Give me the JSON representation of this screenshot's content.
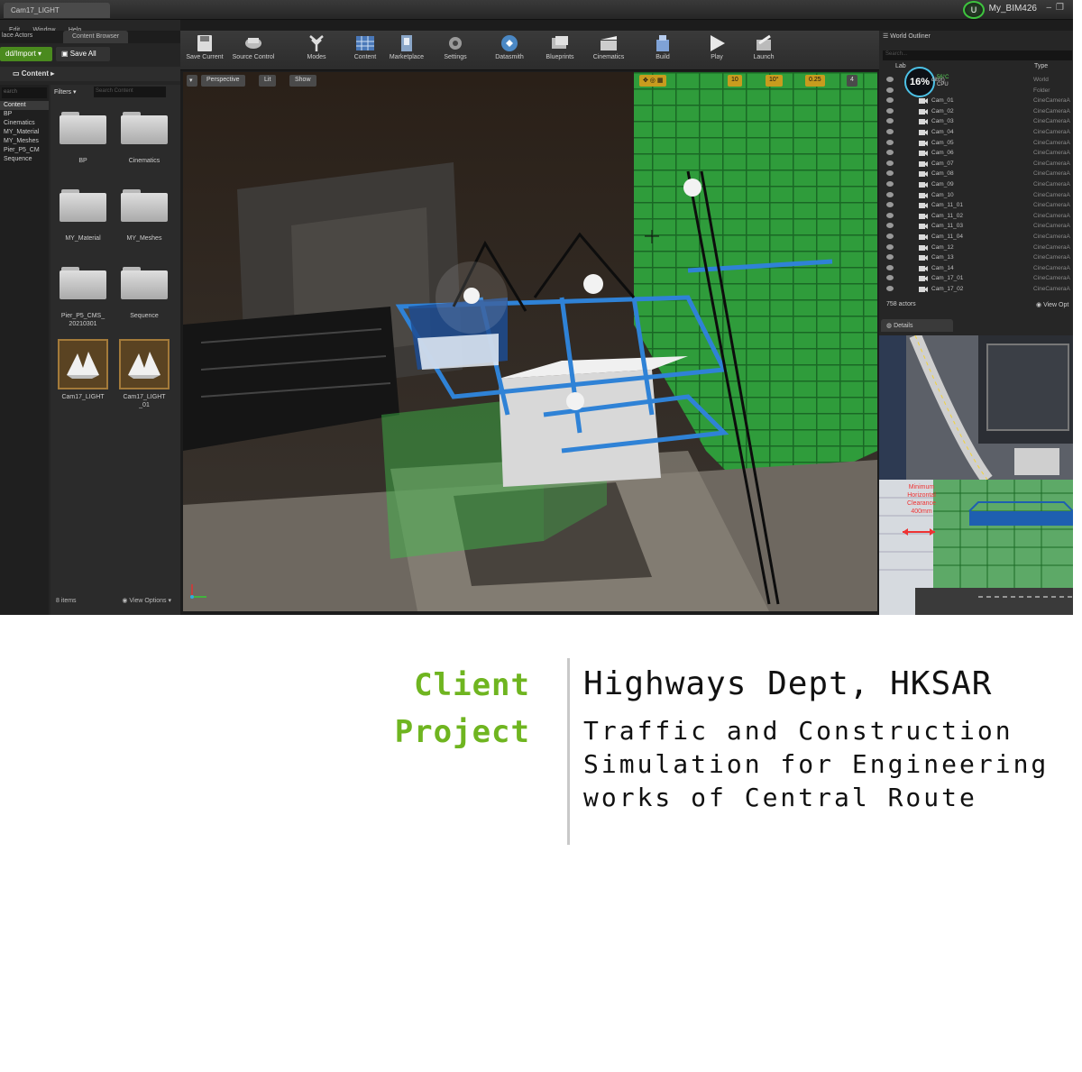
{
  "editor": {
    "window_tab": "Cam17_LIGHT",
    "project_name": "My_BIM426",
    "menu": [
      "Edit",
      "Window",
      "Help"
    ],
    "left_panel": {
      "tabs": [
        "lace Actors",
        "Content Browser"
      ],
      "add_import": "dd/Import ▾",
      "save_all": "Save All",
      "path": "Content",
      "tree_search": "earch",
      "tree_items": [
        "Content",
        "BP",
        "Cinematics",
        "MY_Material",
        "MY_Meshes",
        "Pier_P5_CM",
        "Sequence"
      ],
      "filters": "Filters ▾",
      "search_placeholder": "Search Content",
      "assets": [
        {
          "label": "BP",
          "kind": "folder"
        },
        {
          "label": "Cinematics",
          "kind": "folder"
        },
        {
          "label": "MY_Material",
          "kind": "folder"
        },
        {
          "label": "MY_Meshes",
          "kind": "folder"
        },
        {
          "label": "Pier_P5_CMS_20210301",
          "kind": "folder"
        },
        {
          "label": "Sequence",
          "kind": "folder"
        },
        {
          "label": "Cam17_LIGHT",
          "kind": "blueprint"
        },
        {
          "label": "Cam17_LIGHT_01",
          "kind": "blueprint"
        }
      ],
      "item_count": "8 items",
      "view_options": "View Options ▾"
    },
    "toolbar": [
      {
        "label": "Save Current",
        "icon": "save-icon"
      },
      {
        "label": "Source Control",
        "icon": "source-control-icon"
      },
      {
        "label": "Modes",
        "icon": "modes-icon"
      },
      {
        "label": "Content",
        "icon": "content-icon"
      },
      {
        "label": "Marketplace",
        "icon": "marketplace-icon"
      },
      {
        "label": "Settings",
        "icon": "settings-icon"
      },
      {
        "label": "Datasmith",
        "icon": "datasmith-icon"
      },
      {
        "label": "Blueprints",
        "icon": "blueprints-icon"
      },
      {
        "label": "Cinematics",
        "icon": "cinematics-icon"
      },
      {
        "label": "Build",
        "icon": "build-icon"
      },
      {
        "label": "Play",
        "icon": "play-icon"
      },
      {
        "label": "Launch",
        "icon": "launch-icon"
      }
    ],
    "viewport": {
      "perspective": "Perspective",
      "lit": "Lit",
      "show": "Show",
      "grid_snap": "10",
      "rotation_snap": "10°",
      "scale_snap": "0.25",
      "camera_speed": "4"
    },
    "outliner": {
      "title": "World Outliner",
      "search_placeholder": "Search...",
      "col_label": "Lab",
      "col_type": "Type",
      "cpu_percent": "16%",
      "temperature": "56°C",
      "cpu_label": "CPU",
      "rows": [
        {
          "name": "ditor)",
          "type": "World"
        },
        {
          "name": "",
          "type": "Folder"
        },
        {
          "name": "Cam_01",
          "type": "CineCameraA"
        },
        {
          "name": "Cam_02",
          "type": "CineCameraA"
        },
        {
          "name": "Cam_03",
          "type": "CineCameraA"
        },
        {
          "name": "Cam_04",
          "type": "CineCameraA"
        },
        {
          "name": "Cam_05",
          "type": "CineCameraA"
        },
        {
          "name": "Cam_06",
          "type": "CineCameraA"
        },
        {
          "name": "Cam_07",
          "type": "CineCameraA"
        },
        {
          "name": "Cam_08",
          "type": "CineCameraA"
        },
        {
          "name": "Cam_09",
          "type": "CineCameraA"
        },
        {
          "name": "Cam_10",
          "type": "CineCameraA"
        },
        {
          "name": "Cam_11_01",
          "type": "CineCameraA"
        },
        {
          "name": "Cam_11_02",
          "type": "CineCameraA"
        },
        {
          "name": "Cam_11_03",
          "type": "CineCameraA"
        },
        {
          "name": "Cam_11_04",
          "type": "CineCameraA"
        },
        {
          "name": "Cam_12",
          "type": "CineCameraA"
        },
        {
          "name": "Cam_13",
          "type": "CineCameraA"
        },
        {
          "name": "Cam_14",
          "type": "CineCameraA"
        },
        {
          "name": "Cam_17_01",
          "type": "CineCameraA"
        },
        {
          "name": "Cam_17_02",
          "type": "CineCameraA"
        }
      ],
      "actor_count": "758 actors",
      "view_options": "View Opt"
    },
    "details_tab": "Details",
    "clearance_note": "Minimum Horizontal Clearance 400mm"
  },
  "caption": {
    "client_label": "Client",
    "project_label": "Project",
    "client_value": "Highways Dept, HKSAR",
    "project_value": "Traffic and Construction Simulation for Engineering works of Central Route"
  },
  "colors": {
    "accent_green": "#6fb520",
    "editor_bg": "#1c1c1c",
    "divider": "#c9c9c9",
    "ue_green": "#3ec43e"
  }
}
